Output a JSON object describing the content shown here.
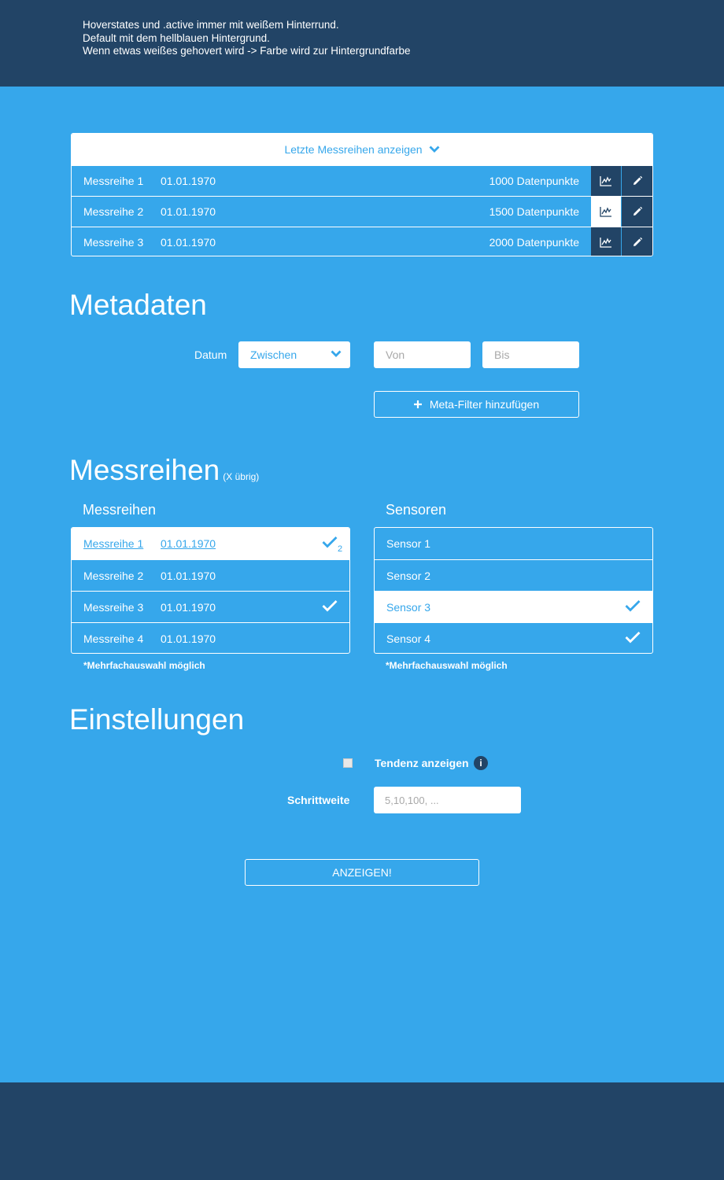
{
  "notes": [
    "Hoverstates und .active immer mit weißem Hinterrund.",
    "Default mit dem hellblauen Hintergrund.",
    "Wenn etwas weißes gehovert wird -> Farbe wird zur Hintergrundfarbe"
  ],
  "recent": {
    "header": "Letzte Messreihen anzeigen",
    "rows": [
      {
        "name": "Messreihe 1",
        "date": "01.01.1970",
        "points": "1000 Datenpunkte"
      },
      {
        "name": "Messreihe 2",
        "date": "01.01.1970",
        "points": "1500 Datenpunkte"
      },
      {
        "name": "Messreihe 3",
        "date": "01.01.1970",
        "points": "2000 Datenpunkte"
      }
    ]
  },
  "metadaten": {
    "title": "Metadaten",
    "datum_label": "Datum",
    "select_value": "Zwischen",
    "von_placeholder": "Von",
    "bis_placeholder": "Bis",
    "add_filter": "Meta-Filter hinzufügen"
  },
  "messreihen": {
    "title": "Messreihen",
    "subtitle": "(X übrig)",
    "list_title": "Messreihen",
    "rows": [
      {
        "name": "Messreihe 1",
        "date": "01.01.1970",
        "badge": "2"
      },
      {
        "name": "Messreihe 2",
        "date": "01.01.1970"
      },
      {
        "name": "Messreihe 3",
        "date": "01.01.1970"
      },
      {
        "name": "Messreihe 4",
        "date": "01.01.1970"
      }
    ],
    "hint": "*Mehrfachauswahl möglich"
  },
  "sensoren": {
    "list_title": "Sensoren",
    "rows": [
      "Sensor 1",
      "Sensor 2",
      "Sensor 3",
      "Sensor 4"
    ],
    "hint": "*Mehrfachauswahl möglich"
  },
  "einstellungen": {
    "title": "Einstellungen",
    "tendenz_label": "Tendenz anzeigen",
    "info": "i",
    "schrittweite_label": "Schrittweite",
    "schrittweite_placeholder": "5,10,100, ..."
  },
  "submit": "ANZEIGEN!",
  "colors": {
    "background": "#36a7eb",
    "dark": "#224466",
    "white": "#ffffff"
  }
}
